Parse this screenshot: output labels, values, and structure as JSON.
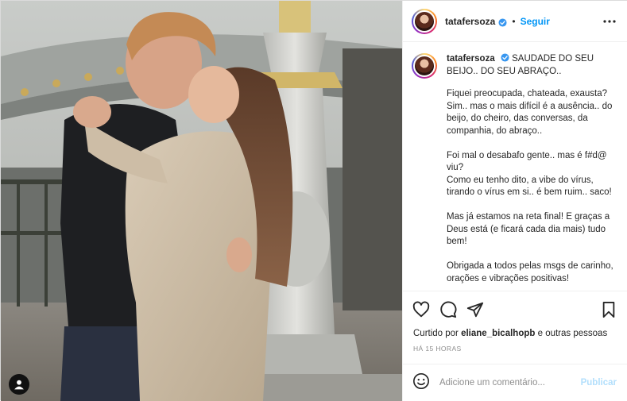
{
  "post": {
    "username": "tatafersoza",
    "follow_label": "Seguir",
    "separator": "•"
  },
  "caption": {
    "username": "tatafersoza",
    "headline": "SAUDADE DO SEU BEIJO.. DO SEU ABRAÇO..",
    "body": "Fiquei preocupada, chateada, exausta? Sim.. mas o mais difícil é a ausência.. do beijo, do cheiro, das conversas, da companhia, do abraço..\n\nFoi mal o desabafo gente.. mas é f#d@ viu?\nComo eu tenho dito, a vibe do vírus, tirando o vírus em si.. é bem ruim.. saco!\n\nMas já estamos na reta final! E graças a Deus está (e ficará cada dia mais) tudo bem!\n\nObrigada a todos pelas msgs de carinho, orações e vibrações positivas!"
  },
  "likes": {
    "prefix": "Curtido por",
    "user": "eliane_bicalhopb",
    "suffix": "e outras pessoas"
  },
  "timestamp": "HÁ 15 HORAS",
  "comment": {
    "placeholder": "Adicione um comentário...",
    "publish_label": "Publicar"
  },
  "icons": {
    "verified": "verified-badge-icon",
    "more": "more-options-icon",
    "like": "heart-icon",
    "comment": "comment-bubble-icon",
    "share": "paper-plane-icon",
    "save": "bookmark-icon",
    "emoji": "emoji-icon",
    "tag": "person-tag-icon"
  },
  "colors": {
    "accent": "#0095f6",
    "publish_disabled": "#b2dffc",
    "muted": "#8e8e8e"
  }
}
